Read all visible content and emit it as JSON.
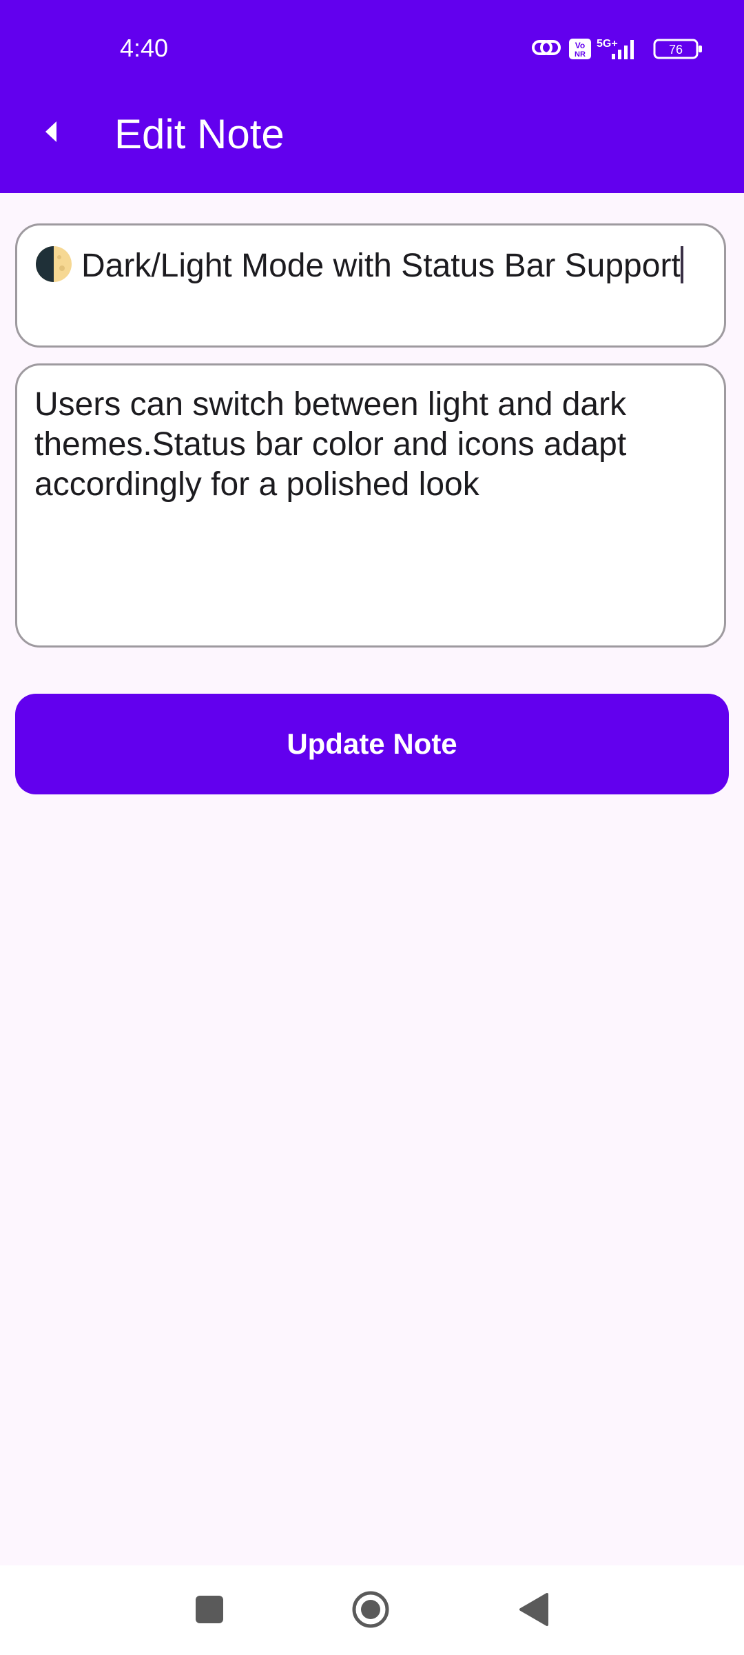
{
  "status_bar": {
    "time": "4:40",
    "network_label": "5G+",
    "volte_label": "Vo NR",
    "battery_level": "76",
    "icons": [
      "link-icon",
      "vonr-icon",
      "signal-icon",
      "battery-icon"
    ]
  },
  "app_bar": {
    "title": "Edit Note",
    "back_icon": "back-arrow-icon"
  },
  "form": {
    "title_value": "Dark/Light Mode with Status Bar Support",
    "title_emoji_icon": "moon-icon",
    "content_value": "Users can switch between light and dark themes.Status bar color and icons adapt accordingly for a polished look",
    "update_button_label": "Update Note"
  },
  "nav_bar": {
    "icons": [
      "recents-square-icon",
      "home-circle-icon",
      "back-triangle-icon"
    ]
  },
  "colors": {
    "primary": "#6200EE",
    "background": "#FDF6FE",
    "field_border": "#9E9A9F",
    "text": "#1C1B1F"
  }
}
